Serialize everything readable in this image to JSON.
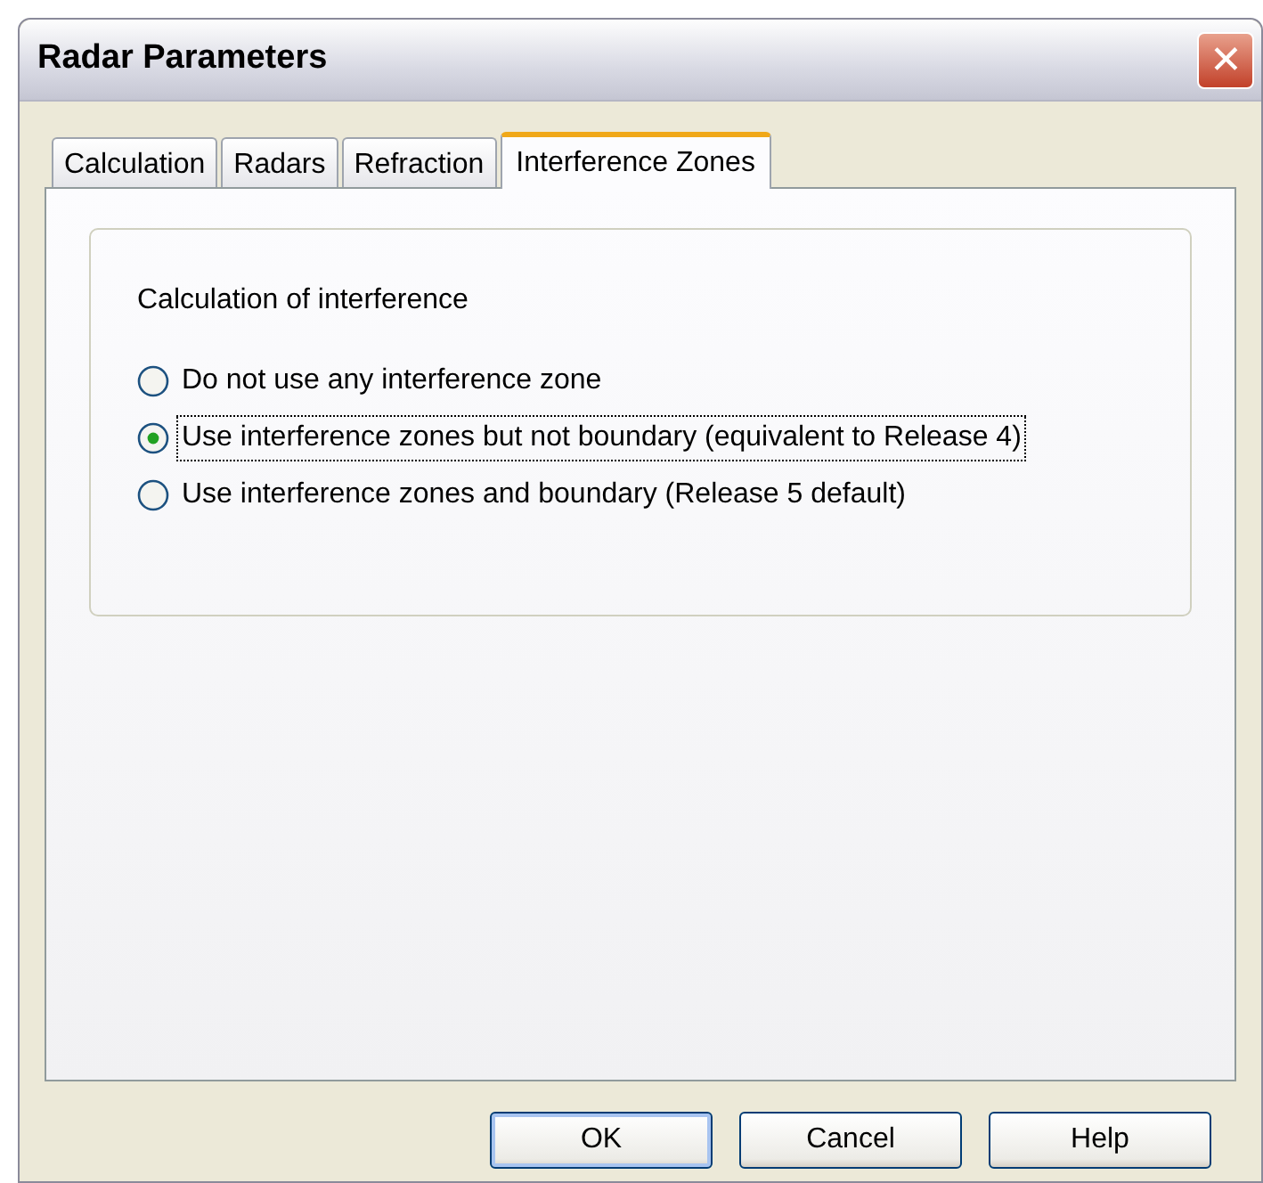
{
  "window": {
    "title": "Radar Parameters",
    "close": "✕"
  },
  "tabs": [
    {
      "label": "Calculation",
      "selected": false
    },
    {
      "label": "Radars",
      "selected": false
    },
    {
      "label": "Refraction",
      "selected": false
    },
    {
      "label": "Interference Zones",
      "selected": true
    }
  ],
  "group": {
    "label": "Calculation of interference",
    "options": [
      {
        "label": "Do not use any interference zone",
        "selected": false,
        "focused": false
      },
      {
        "label": "Use interference zones but not boundary (equivalent to Release 4)",
        "selected": true,
        "focused": true
      },
      {
        "label": "Use interference zones and boundary (Release 5 default)",
        "selected": false,
        "focused": false
      }
    ]
  },
  "buttons": [
    {
      "label": "OK",
      "default": true
    },
    {
      "label": "Cancel",
      "default": false
    },
    {
      "label": "Help",
      "default": false
    }
  ]
}
